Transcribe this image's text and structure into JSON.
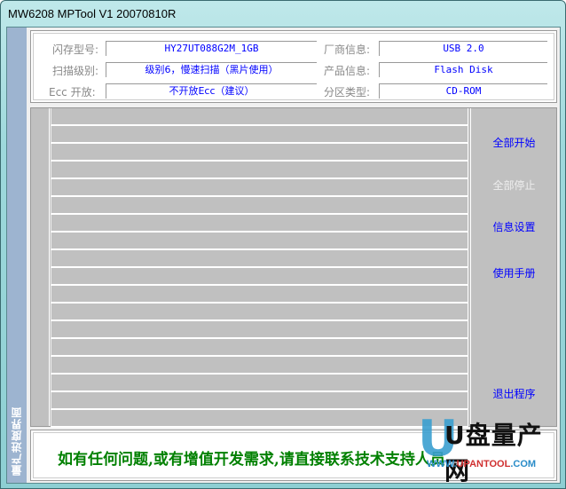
{
  "window": {
    "title": "MW6208 MPTool V1 20070810R"
  },
  "sidebar": {
    "label": "量产进度界面"
  },
  "info": {
    "flash_model_label": "闪存型号:",
    "flash_model_value": "HY27UT088G2M_1GB",
    "scan_level_label": "扫描级别:",
    "scan_level_value": "级别6，慢速扫描（黑片使用）",
    "ecc_label": "Ecc 开放:",
    "ecc_value": "不开放Ecc（建议）",
    "vendor_label": "厂商信息:",
    "vendor_value": "USB 2.0",
    "product_label": "产品信息:",
    "product_value": "Flash Disk",
    "partition_label": "分区类型:",
    "partition_value": "CD-ROM"
  },
  "actions": {
    "start_all": "全部开始",
    "stop_all": "全部停止",
    "info_settings": "信息设置",
    "manual": "使用手册",
    "exit": "退出程序"
  },
  "footer": {
    "message": "如有任何问题,或有增值开发需求,请直接联系技术支持人员"
  },
  "watermark": {
    "logo": "U盘量产网",
    "url_prefix": "WWW.",
    "url_main": "UPANTOOL",
    "url_suffix": ".COM"
  },
  "colors": {
    "value_text": "#0000ff",
    "footer_text": "#008000",
    "disabled_text": "#eeeeee",
    "grid_bg": "#c0c0c0"
  }
}
